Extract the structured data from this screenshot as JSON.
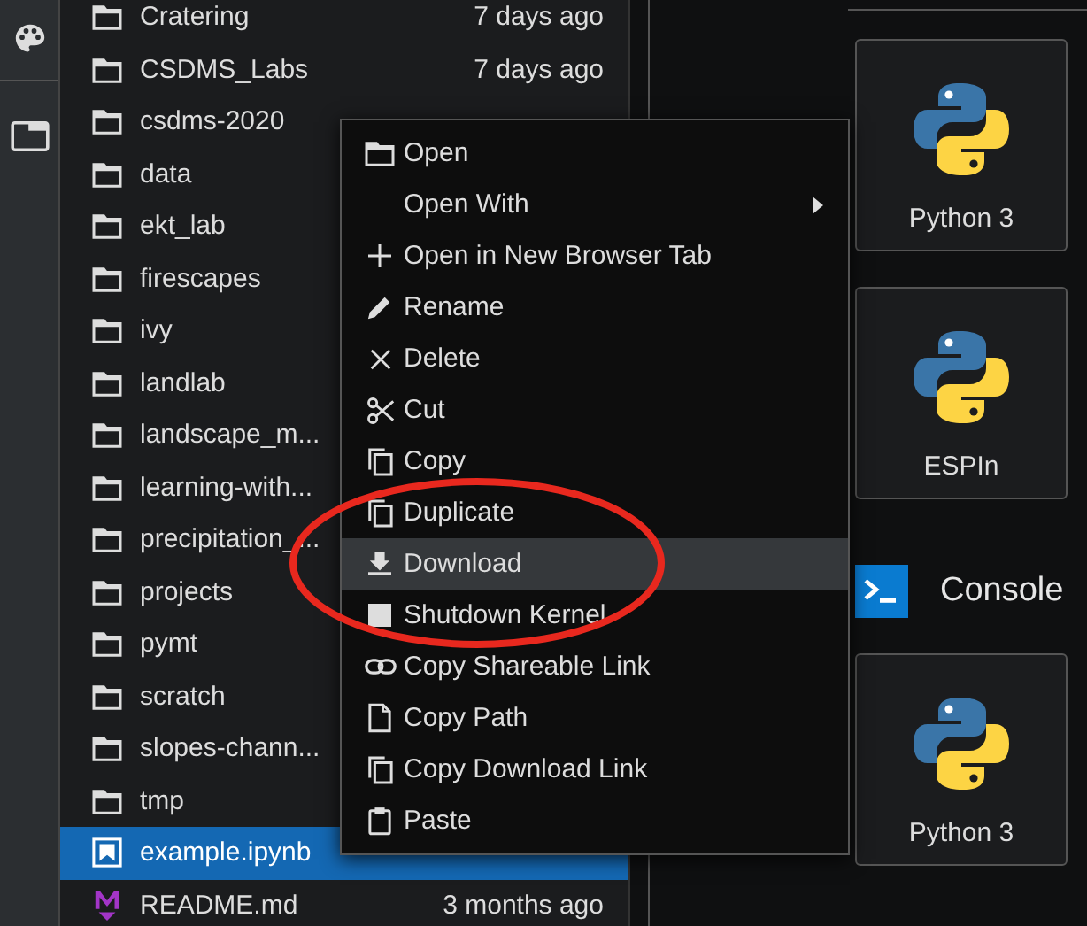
{
  "files": [
    {
      "name": "Cratering",
      "modified": "7 days ago",
      "kind": "folder",
      "selected": false
    },
    {
      "name": "CSDMS_Labs",
      "modified": "7 days ago",
      "kind": "folder",
      "selected": false
    },
    {
      "name": "csdms-2020",
      "kind": "folder",
      "selected": false
    },
    {
      "name": "data",
      "kind": "folder",
      "selected": false
    },
    {
      "name": "ekt_lab",
      "kind": "folder",
      "selected": false
    },
    {
      "name": "firescapes",
      "kind": "folder",
      "selected": false
    },
    {
      "name": "ivy",
      "kind": "folder",
      "selected": false
    },
    {
      "name": "landlab",
      "kind": "folder",
      "selected": false
    },
    {
      "name": "landscape_m...",
      "kind": "folder",
      "selected": false
    },
    {
      "name": "learning-with...",
      "kind": "folder",
      "selected": false
    },
    {
      "name": "precipitation_...",
      "kind": "folder",
      "selected": false
    },
    {
      "name": "projects",
      "kind": "folder",
      "selected": false
    },
    {
      "name": "pymt",
      "kind": "folder",
      "selected": false
    },
    {
      "name": "scratch",
      "kind": "folder",
      "selected": false
    },
    {
      "name": "slopes-chann...",
      "kind": "folder",
      "selected": false
    },
    {
      "name": "tmp",
      "kind": "folder",
      "selected": false
    },
    {
      "name": "example.ipynb",
      "kind": "notebook",
      "selected": true
    },
    {
      "name": "README.md",
      "modified": "3 months ago",
      "kind": "markdown",
      "selected": false
    }
  ],
  "context_menu": [
    {
      "label": "Open",
      "kind": "folder",
      "selected": false
    },
    {
      "label": "Open With",
      "kind": "submenu",
      "selected": false
    },
    {
      "label": "Open in New Browser Tab",
      "kind": "plus",
      "selected": false
    },
    {
      "label": "Rename",
      "kind": "pencil",
      "selected": false
    },
    {
      "label": "Delete",
      "kind": "close",
      "selected": false
    },
    {
      "label": "Cut",
      "kind": "scissors",
      "selected": false
    },
    {
      "label": "Copy",
      "kind": "copy",
      "selected": false
    },
    {
      "label": "Duplicate",
      "kind": "copy",
      "selected": false
    },
    {
      "label": "Download",
      "kind": "download",
      "selected": true
    },
    {
      "label": "Shutdown Kernel",
      "kind": "stop",
      "selected": false
    },
    {
      "label": "Copy Shareable Link",
      "kind": "link",
      "selected": false
    },
    {
      "label": "Copy Path",
      "kind": "file",
      "selected": false
    },
    {
      "label": "Copy Download Link",
      "kind": "copy",
      "selected": false
    },
    {
      "label": "Paste",
      "kind": "paste",
      "selected": false
    }
  ],
  "launcher": [
    {
      "label": "Python 3",
      "kind": "card"
    },
    {
      "label": "ESPIn",
      "kind": "card"
    },
    {
      "label": "Console",
      "kind": "section"
    },
    {
      "label": "Python 3",
      "kind": "card"
    }
  ]
}
